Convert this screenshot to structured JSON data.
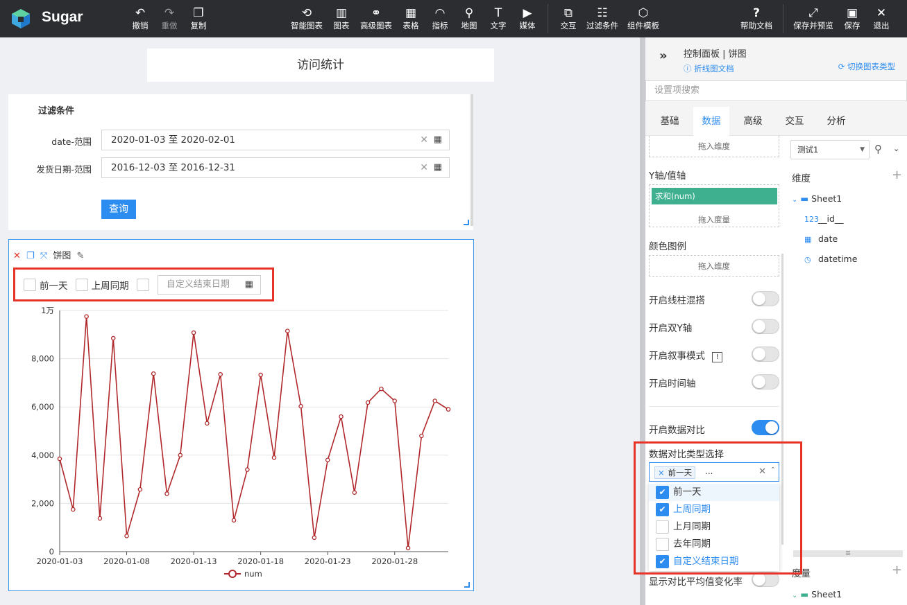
{
  "app": {
    "name": "Sugar"
  },
  "toolbar": {
    "undo": "撤销",
    "redo": "重做",
    "copy": "复制",
    "smart_chart": "智能图表",
    "chart": "图表",
    "advanced_chart": "高级图表",
    "table": "表格",
    "indicator": "指标",
    "map": "地图",
    "text": "文字",
    "media": "媒体",
    "interact": "交互",
    "filter": "过滤条件",
    "component_template": "组件模板",
    "help": "帮助文档",
    "save_preview": "保存并预览",
    "save": "保存",
    "exit": "退出"
  },
  "canvas": {
    "title": "访问统计",
    "filter": {
      "title": "过滤条件",
      "date_label": "date-范围",
      "date_value": "2020-01-03 至 2020-02-01",
      "ship_label": "发货日期-范围",
      "ship_value": "2016-12-03 至 2016-12-31",
      "query_button": "查询"
    },
    "chart_card": {
      "title": "饼图",
      "compare_options": [
        "前一天",
        "上周同期"
      ],
      "custom_end_placeholder": "自定义结束日期"
    }
  },
  "chart_data": {
    "type": "line",
    "series": [
      {
        "name": "num",
        "color": "#b0282b",
        "values": [
          3850,
          1750,
          9750,
          1380,
          8850,
          650,
          2580,
          7380,
          2400,
          4000,
          9080,
          5320,
          7350,
          1300,
          3400,
          7330,
          3900,
          9150,
          6030,
          580,
          3800,
          5600,
          2450,
          6180,
          6750,
          6250,
          150,
          4800,
          6250,
          5900
        ]
      }
    ],
    "x_start": "2020-01-03",
    "x_end": "2020-02-01",
    "x_ticks": [
      "2020-01-03",
      "2020-01-08",
      "2020-01-13",
      "2020-01-18",
      "2020-01-23",
      "2020-01-28"
    ],
    "y_ticks": [
      "0",
      "2,000",
      "4,000",
      "6,000",
      "8,000",
      "1万"
    ],
    "ylim": [
      0,
      10000
    ],
    "legend": "bottom-center",
    "grid": true
  },
  "panel": {
    "header_title": "控制面板 | 饼图",
    "doc_link": "折线图文档",
    "switch_type": "切换图表类型",
    "search_placeholder": "设置项搜索",
    "tabs": [
      "基础",
      "数据",
      "高级",
      "交互",
      "分析"
    ],
    "active_tab": "数据",
    "drop_dimension": "拖入维度",
    "y_axis_label": "Y轴/值轴",
    "measure_chip": "求和(num)",
    "drop_measure": "拖入度量",
    "color_legend_label": "颜色图例",
    "drop_dimension2": "拖入维度",
    "toggles": [
      {
        "label": "开启线柱混搭",
        "on": false
      },
      {
        "label": "开启双Y轴",
        "on": false
      },
      {
        "label": "开启叙事模式",
        "on": false
      },
      {
        "label": "开启时间轴",
        "on": false
      },
      {
        "label": "开启数据对比",
        "on": true
      }
    ],
    "compare_type_label": "数据对比类型选择",
    "compare_selected_tag": "前一天",
    "compare_more": "...",
    "compare_options": [
      {
        "label": "前一天",
        "checked": true
      },
      {
        "label": "上周同期",
        "checked": true
      },
      {
        "label": "上月同期",
        "checked": false
      },
      {
        "label": "去年同期",
        "checked": false
      },
      {
        "label": "自定义结束日期",
        "checked": true
      }
    ],
    "show_avg_change": "显示对比平均值变化率",
    "dataset": "测试1",
    "dimension_label": "维度",
    "sheet": "Sheet1",
    "fields": [
      {
        "type": "123",
        "name": "__id__"
      },
      {
        "type": "date",
        "name": "date"
      },
      {
        "type": "datetime",
        "name": "datetime"
      }
    ],
    "measure_label": "度量",
    "measure_sheet": "Sheet1"
  },
  "colors": {
    "accent": "#2d8cf0",
    "highlight_frame": "#e53327",
    "measure_chip": "#3eb08f",
    "line": "#b0282b"
  }
}
